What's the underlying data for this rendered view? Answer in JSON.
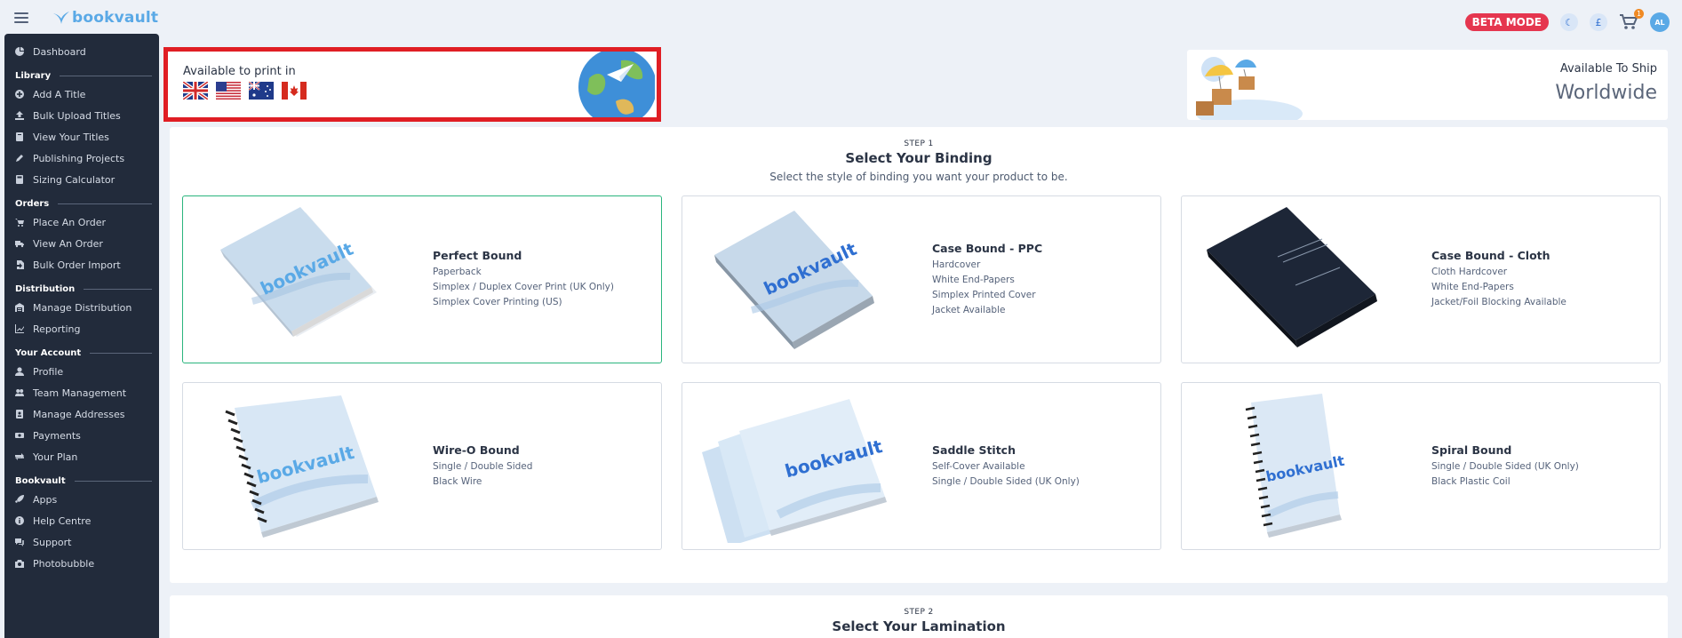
{
  "app": {
    "logo_text": "bookvault"
  },
  "topbar": {
    "beta_label": "BETA MODE",
    "cart_count": "1",
    "avatar_initials": "AL"
  },
  "sidebar": {
    "sections": [
      {
        "title": "",
        "items": [
          {
            "label": "Dashboard",
            "icon": "dashboard-icon"
          }
        ]
      },
      {
        "title": "Library",
        "items": [
          {
            "label": "Add A Title",
            "icon": "plus-circle-icon"
          },
          {
            "label": "Bulk Upload Titles",
            "icon": "upload-icon"
          },
          {
            "label": "View Your Titles",
            "icon": "book-icon"
          },
          {
            "label": "Publishing Projects",
            "icon": "pen-icon"
          },
          {
            "label": "Sizing Calculator",
            "icon": "calculator-icon"
          }
        ]
      },
      {
        "title": "Orders",
        "items": [
          {
            "label": "Place An Order",
            "icon": "cart-icon"
          },
          {
            "label": "View An Order",
            "icon": "truck-icon"
          },
          {
            "label": "Bulk Order Import",
            "icon": "file-import-icon"
          }
        ]
      },
      {
        "title": "Distribution",
        "items": [
          {
            "label": "Manage Distribution",
            "icon": "warehouse-icon"
          },
          {
            "label": "Reporting",
            "icon": "chart-line-icon"
          }
        ]
      },
      {
        "title": "Your Account",
        "items": [
          {
            "label": "Profile",
            "icon": "user-icon"
          },
          {
            "label": "Team Management",
            "icon": "users-icon"
          },
          {
            "label": "Manage Addresses",
            "icon": "address-book-icon"
          },
          {
            "label": "Payments",
            "icon": "money-icon"
          },
          {
            "label": "Your Plan",
            "icon": "exchange-icon"
          }
        ]
      },
      {
        "title": "Bookvault",
        "items": [
          {
            "label": "Apps",
            "icon": "rocket-icon"
          },
          {
            "label": "Help Centre",
            "icon": "info-icon"
          },
          {
            "label": "Support",
            "icon": "comments-icon"
          },
          {
            "label": "Photobubble",
            "icon": "camera-icon"
          }
        ]
      }
    ]
  },
  "availability": {
    "print_label": "Available to print in",
    "flags": [
      "flag-uk-icon",
      "flag-us-icon",
      "flag-au-icon",
      "flag-ca-icon"
    ],
    "ship_label": "Available To Ship",
    "ship_value": "Worldwide"
  },
  "step1": {
    "step": "STEP 1",
    "title": "Select Your Binding",
    "subtitle": "Select the style of binding you want your product to be.",
    "options": [
      {
        "name": "Perfect Bound",
        "details": [
          "Paperback",
          "Simplex / Duplex Cover Print (UK Only)",
          "Simplex Cover Printing (US)"
        ],
        "selected": true
      },
      {
        "name": "Case Bound - PPC",
        "details": [
          "Hardcover",
          "White End-Papers",
          "Simplex Printed Cover",
          "Jacket Available"
        ],
        "selected": false
      },
      {
        "name": "Case Bound - Cloth",
        "details": [
          "Cloth Hardcover",
          "White End-Papers",
          "Jacket/Foil Blocking Available"
        ],
        "selected": false
      },
      {
        "name": "Wire-O Bound",
        "details": [
          "Single / Double Sided",
          "Black Wire"
        ],
        "selected": false
      },
      {
        "name": "Saddle Stitch",
        "details": [
          "Self-Cover Available",
          "Single / Double Sided (UK Only)"
        ],
        "selected": false
      },
      {
        "name": "Spiral Bound",
        "details": [
          "Single / Double Sided (UK Only)",
          "Black Plastic Coil"
        ],
        "selected": false
      }
    ]
  },
  "step2": {
    "step": "STEP 2",
    "title": "Select Your Lamination"
  },
  "colors": {
    "sidebar_bg": "#222b3b",
    "accent": "#5aa9e6",
    "beta": "#e5364f",
    "selected_border": "#2ab57d",
    "highlight_border": "#e01e24"
  }
}
